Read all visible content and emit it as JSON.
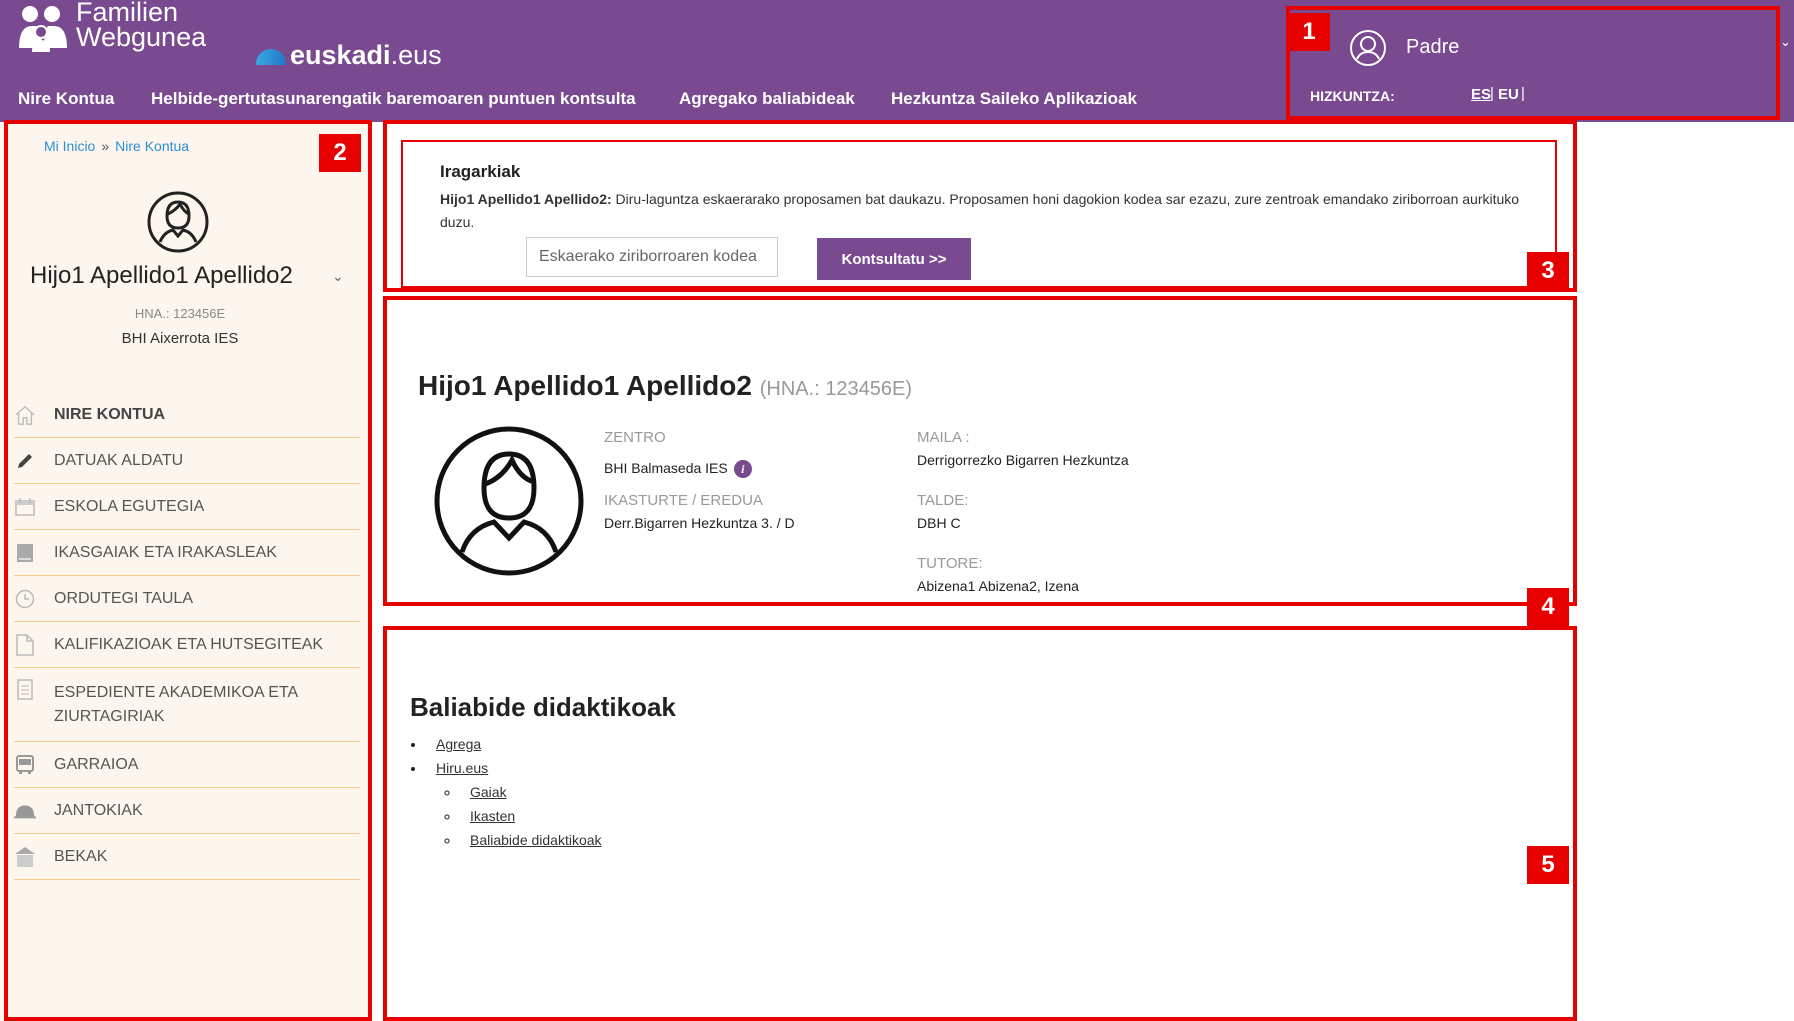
{
  "header": {
    "logo_line1": "Familien",
    "logo_line2": "Webgunea",
    "euskadi_bold": "euskadi",
    "euskadi_suffix": ".eus",
    "nav": [
      "Nire Kontua",
      "Helbide-gertutasunarengatik baremoaren puntuen kontsulta",
      "Agregako baliabideak",
      "Hezkuntza Saileko Aplikazioak"
    ],
    "user_name": "Padre",
    "language_label": "HIZKUNTZA:",
    "lang_es": "ES",
    "lang_eu": "EU",
    "lang_sep": "|"
  },
  "annotations": [
    "1",
    "2",
    "3",
    "4",
    "5"
  ],
  "sidebar": {
    "breadcrumb_home": "Mi Inicio",
    "breadcrumb_sep": "»",
    "breadcrumb_current": "Nire Kontua",
    "student_name": "Hijo1 Apellido1 Apellido2",
    "hna": "HNA.: 123456E",
    "school": "BHI Aixerrota IES",
    "menu": [
      {
        "label": "NIRE KONTUA",
        "icon": "home-icon"
      },
      {
        "label": "DATUAK ALDATU",
        "icon": "pencil-icon"
      },
      {
        "label": "ESKOLA EGUTEGIA",
        "icon": "calendar-icon"
      },
      {
        "label": "IKASGAIAK ETA IRAKASLEAK",
        "icon": "book-icon"
      },
      {
        "label": "ORDUTEGI TAULA",
        "icon": "clock-icon"
      },
      {
        "label": "KALIFIKAZIOAK ETA HUTSEGITEAK",
        "icon": "document-icon"
      },
      {
        "label": "ESPEDIENTE AKADEMIKOA ETA ZIURTAGIRIAK",
        "icon": "clipboard-icon"
      },
      {
        "label": "GARRAIOA",
        "icon": "bus-icon"
      },
      {
        "label": "JANTOKIAK",
        "icon": "cloche-icon"
      },
      {
        "label": "BEKAK",
        "icon": "building-icon"
      }
    ]
  },
  "notices": {
    "title": "Iragarkiak",
    "student_bold": "Hijo1 Apellido1 Apellido2:",
    "text": " Diru-laguntza eskaerarako proposamen bat daukazu. Proposamen honi dagokion kodea sar ezazu, zure zentroak emandako ziriborroan aurkituko duzu.",
    "input_placeholder": "Eskaerako ziriborroaren kodea",
    "button_label": "Kontsultatu >>"
  },
  "student": {
    "name": "Hijo1 Apellido1 Apellido2",
    "hna": "(HNA.: 123456E)",
    "centre_label": "ZENTRO",
    "centre_value": "BHI Balmaseda IES",
    "year_label": "IKASTURTE / EREDUA",
    "year_value": "Derr.Bigarren Hezkuntza 3.   /   D",
    "level_label": "MAILA :",
    "level_value": "Derrigorrezko Bigarren Hezkuntza",
    "group_label": "TALDE:",
    "group_value": "DBH C",
    "tutor_label": "TUTORE:",
    "tutor_value": "Abizena1 Abizena2, Izena"
  },
  "resources": {
    "title": "Baliabide didaktikoak",
    "items": [
      "Agrega",
      "Hiru.eus"
    ],
    "sub_items": [
      "Gaiak",
      "Ikasten",
      "Baliabide didaktikoak"
    ]
  }
}
